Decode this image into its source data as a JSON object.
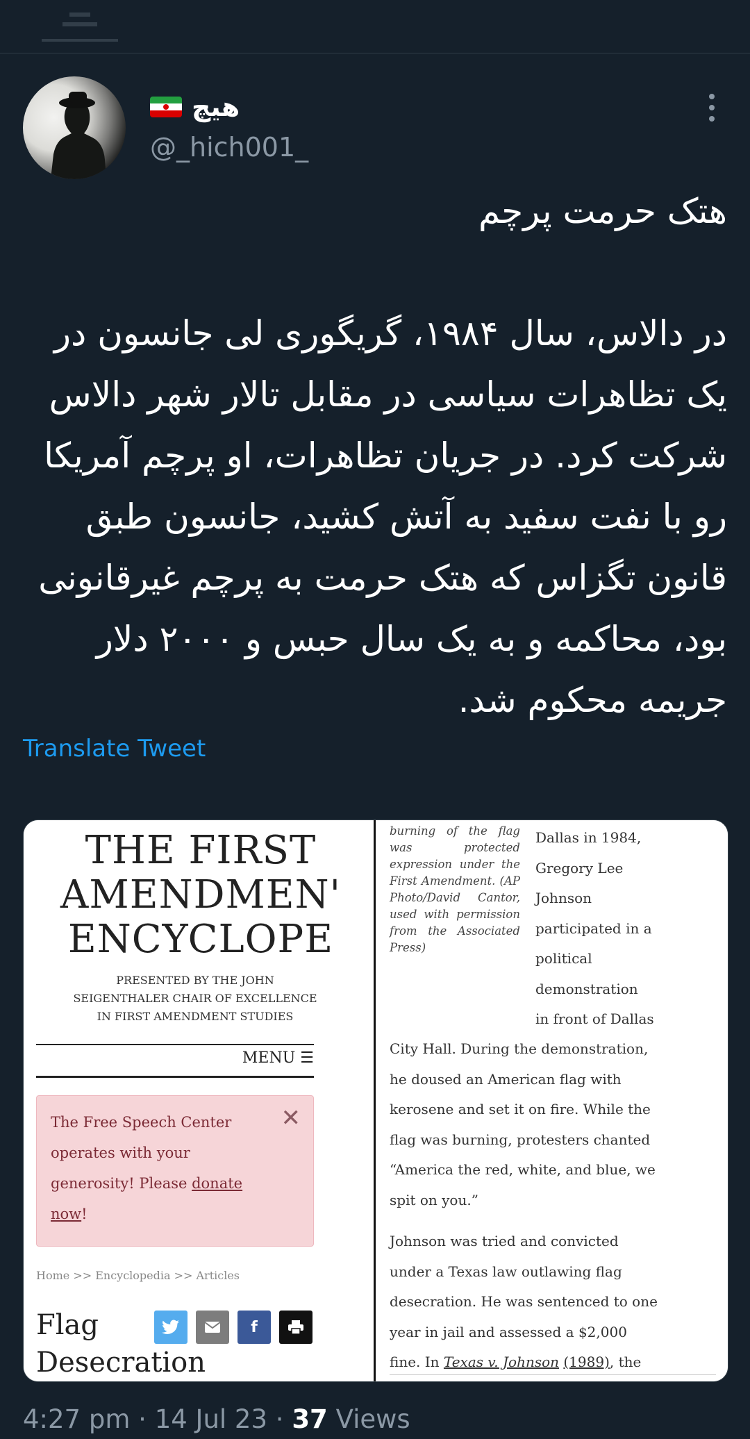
{
  "user": {
    "display_name": "هیچ",
    "handle": "@_hich001_",
    "flag": {
      "colors": [
        "#239f40",
        "#ffffff",
        "#da0000"
      ]
    }
  },
  "tweet": {
    "text": "هتک حرمت پرچم\n\nدر دالاس، سال ۱۹۸۴، گریگوری لی جانسون در یک تظاهرات سیاسی در مقابل تالار شهر دالاس شرکت کرد. در جریان تظاهرات، او پرچم آمریکا رو با نفت سفید به آتش کشید، جانسون طبق قانون تگزاس که هتک حرمت به پرچم غیرقانونی بود، محاکمه و به یک سال حبس و ۲۰۰۰ دلار جریمه محکوم شد.",
    "translate_label": "Translate Tweet"
  },
  "media": {
    "left": {
      "title": "THE FIRST\nAMENDMEN'\nENCYCLOPE",
      "subtitle": "PRESENTED BY THE JOHN\nSEIGENTHALER CHAIR OF EXCELLENCE\nIN FIRST AMENDMENT STUDIES",
      "menu_label": "MENU ☰",
      "donate_pre": "The Free Speech Center operates with your generosity! Please ",
      "donate_link": "donate now",
      "donate_post": "!",
      "breadcrumb": "Home >> Encyclopedia >> Articles",
      "article_title": "Flag\nDesecration"
    },
    "right": {
      "caption": "burning of the flag was protected expression under the First Amendment. (AP Photo/David Cantor, used with permission from the Associated Press)",
      "article_top": "Dallas in 1984,\nGregory Lee\nJohnson\nparticipated in a\npolitical\ndemonstration\nin front of Dallas",
      "article_main": "City Hall. During the demonstration,\nhe doused an American flag with\nkerosene and set it on fire. While the\nflag was burning, protesters chanted\n“America the red, white, and blue, we\nspit on you.”",
      "para2_text": "Johnson was tried and convicted\nunder a Texas law outlawing flag\ndesecration. He was sentenced to one\nyear in jail and assessed a $2,000\nfine. In ",
      "case_name": "Texas v. Johnson",
      "case_year": "(1989)",
      "para2_tail": ", the"
    }
  },
  "meta": {
    "time": "4:27 pm",
    "date": "14 Jul 23",
    "views_count": "37",
    "views_label": "Views"
  },
  "colors": {
    "background": "#15202b",
    "link": "#1d9bf0",
    "muted": "#8b98a5",
    "twitter": "#55acee",
    "email": "#7d7d7d",
    "facebook": "#3b5998",
    "print": "#111111"
  }
}
